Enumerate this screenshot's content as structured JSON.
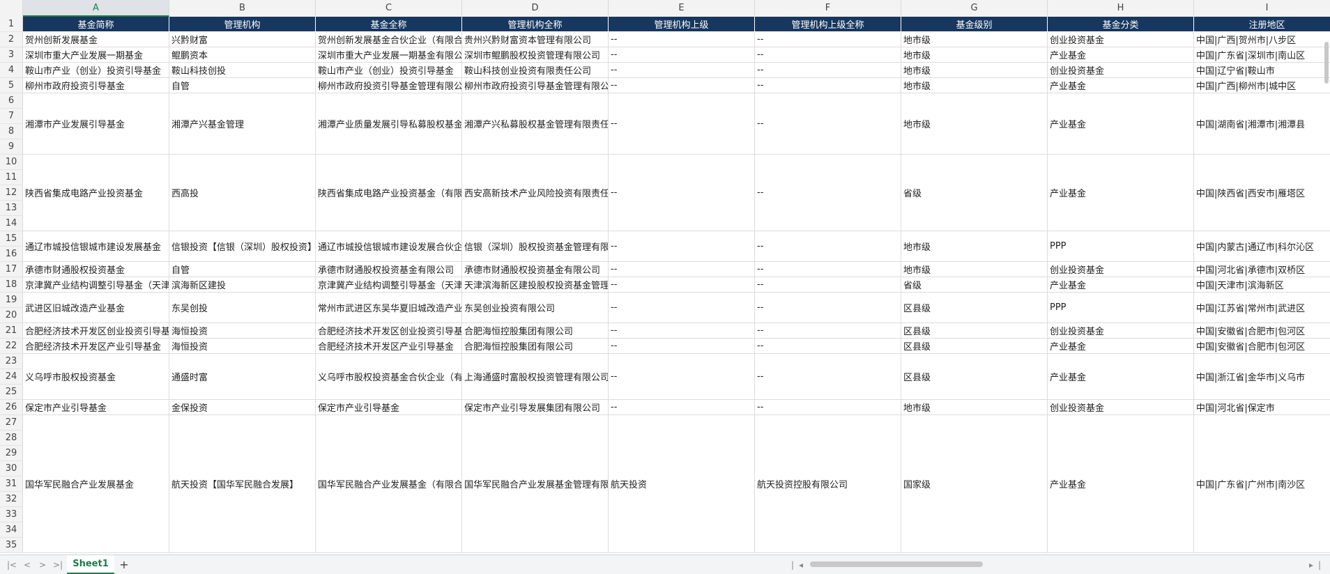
{
  "column_letters": [
    "A",
    "B",
    "C",
    "D",
    "E",
    "F",
    "G",
    "H",
    "I"
  ],
  "selected_column": "A",
  "header_row_number": "1",
  "headers": [
    "基金简称",
    "管理机构",
    "基金全称",
    "管理机构全称",
    "管理机构上级",
    "管理机构上级全称",
    "基金级别",
    "基金分类",
    "注册地区"
  ],
  "rows": [
    {
      "nums": [
        "2"
      ],
      "cells": [
        "贺州创新发展基金",
        "兴黔财富",
        "贺州创新发展基金合伙企业（有限合",
        "贵州兴黔财富资本管理有限公司",
        "--",
        "--",
        "地市级",
        "创业投资基金",
        "中国|广西|贺州市|八步区"
      ]
    },
    {
      "nums": [
        "3"
      ],
      "cells": [
        "深圳市重大产业发展一期基金",
        "鲲鹏资本",
        "深圳市重大产业发展一期基金有限公",
        "深圳市鲲鹏股权投资管理有限公司",
        "--",
        "--",
        "地市级",
        "产业基金",
        "中国|广东省|深圳市|南山区"
      ]
    },
    {
      "nums": [
        "4"
      ],
      "cells": [
        "鞍山市产业（创业）投资引导基金",
        "鞍山科技创投",
        "鞍山市产业（创业）投资引导基金",
        "鞍山科技创业投资有限责任公司",
        "--",
        "--",
        "地市级",
        "创业投资基金",
        "中国|辽宁省|鞍山市"
      ]
    },
    {
      "nums": [
        "5"
      ],
      "cells": [
        "柳州市政府投资引导基金",
        "自管",
        "柳州市政府投资引导基金管理有限公",
        "柳州市政府投资引导基金管理有限公",
        "--",
        "--",
        "地市级",
        "产业基金",
        "中国|广西|柳州市|城中区"
      ]
    },
    {
      "nums": [
        "6",
        "7",
        "8",
        "9"
      ],
      "cells": [
        "湘潭市产业发展引导基金",
        "湘潭产兴基金管理",
        "湘潭产业质量发展引导私募股权基金",
        "湘潭产兴私募股权基金管理有限责任",
        "--",
        "--",
        "地市级",
        "产业基金",
        "中国|湖南省|湘潭市|湘潭县"
      ]
    },
    {
      "nums": [
        "10",
        "11",
        "12",
        "13",
        "14"
      ],
      "cells": [
        "陕西省集成电路产业投资基金",
        "西高投",
        "陕西省集成电路产业投资基金（有限",
        "西安高新技术产业风险投资有限责任",
        "--",
        "--",
        "省级",
        "产业基金",
        "中国|陕西省|西安市|雁塔区"
      ]
    },
    {
      "nums": [
        "15",
        "16"
      ],
      "cells": [
        "通辽市城投信银城市建设发展基金",
        "信银投资【信银（深圳）股权投资】",
        "通辽市城投信银城市建设发展合伙企",
        "信银（深圳）股权投资基金管理有限",
        "--",
        "--",
        "地市级",
        "PPP",
        "中国|内蒙古|通辽市|科尔沁区"
      ]
    },
    {
      "nums": [
        "17"
      ],
      "cells": [
        "承德市财通股权投资基金",
        "自管",
        "承德市财通股权投资基金有限公司",
        "承德市财通股权投资基金有限公司",
        "--",
        "--",
        "地市级",
        "创业投资基金",
        "中国|河北省|承德市|双桥区"
      ]
    },
    {
      "nums": [
        "18"
      ],
      "cells": [
        "京津冀产业结构调整引导基金（天津",
        "滨海新区建投",
        "京津冀产业结构调整引导基金（天津",
        "天津滨海新区建投股权投资基金管理",
        "--",
        "--",
        "省级",
        "产业基金",
        "中国|天津市|滨海新区"
      ]
    },
    {
      "nums": [
        "19",
        "20"
      ],
      "cells": [
        "武进区旧城改造产业基金",
        "东吴创投",
        "常州市武进区东吴华夏旧城改造产业",
        "东吴创业投资有限公司",
        "--",
        "--",
        "区县级",
        "PPP",
        "中国|江苏省|常州市|武进区"
      ]
    },
    {
      "nums": [
        "21"
      ],
      "cells": [
        "合肥经济技术开发区创业投资引导基",
        "海恒投资",
        "合肥经济技术开发区创业投资引导基",
        "合肥海恒控股集团有限公司",
        "--",
        "--",
        "区县级",
        "创业投资基金",
        "中国|安徽省|合肥市|包河区"
      ]
    },
    {
      "nums": [
        "22"
      ],
      "cells": [
        "合肥经济技术开发区产业引导基金",
        "海恒投资",
        "合肥经济技术开发区产业引导基金",
        "合肥海恒控股集团有限公司",
        "--",
        "--",
        "区县级",
        "产业基金",
        "中国|安徽省|合肥市|包河区"
      ]
    },
    {
      "nums": [
        "23",
        "24",
        "25"
      ],
      "cells": [
        "义乌呼市股权投资基金",
        "通盛时富",
        "义乌呼市股权投资基金合伙企业（有",
        "上海通盛时富股权投资管理有限公司",
        "--",
        "--",
        "区县级",
        "产业基金",
        "中国|浙江省|金华市|义乌市"
      ]
    },
    {
      "nums": [
        "26"
      ],
      "cells": [
        "保定市产业引导基金",
        "金保投资",
        "保定市产业引导基金",
        "保定市产业引导发展集团有限公司",
        "--",
        "--",
        "地市级",
        "创业投资基金",
        "中国|河北省|保定市"
      ]
    },
    {
      "nums": [
        "27",
        "28",
        "29",
        "30",
        "31",
        "32",
        "33",
        "34",
        "35"
      ],
      "cells": [
        "国华军民融合产业发展基金",
        "航天投资【国华军民融合发展】",
        "国华军民融合产业发展基金（有限合",
        "国华军民融合产业发展基金管理有限",
        "航天投资",
        "航天投资控股有限公司",
        "国家级",
        "产业基金",
        "中国|广东省|广州市|南沙区"
      ]
    }
  ],
  "sheet_tab": "Sheet1",
  "add_sheet_label": "+",
  "nav_icons": [
    "first-sheet-icon",
    "prev-sheet-icon",
    "next-sheet-icon",
    "last-sheet-icon"
  ]
}
